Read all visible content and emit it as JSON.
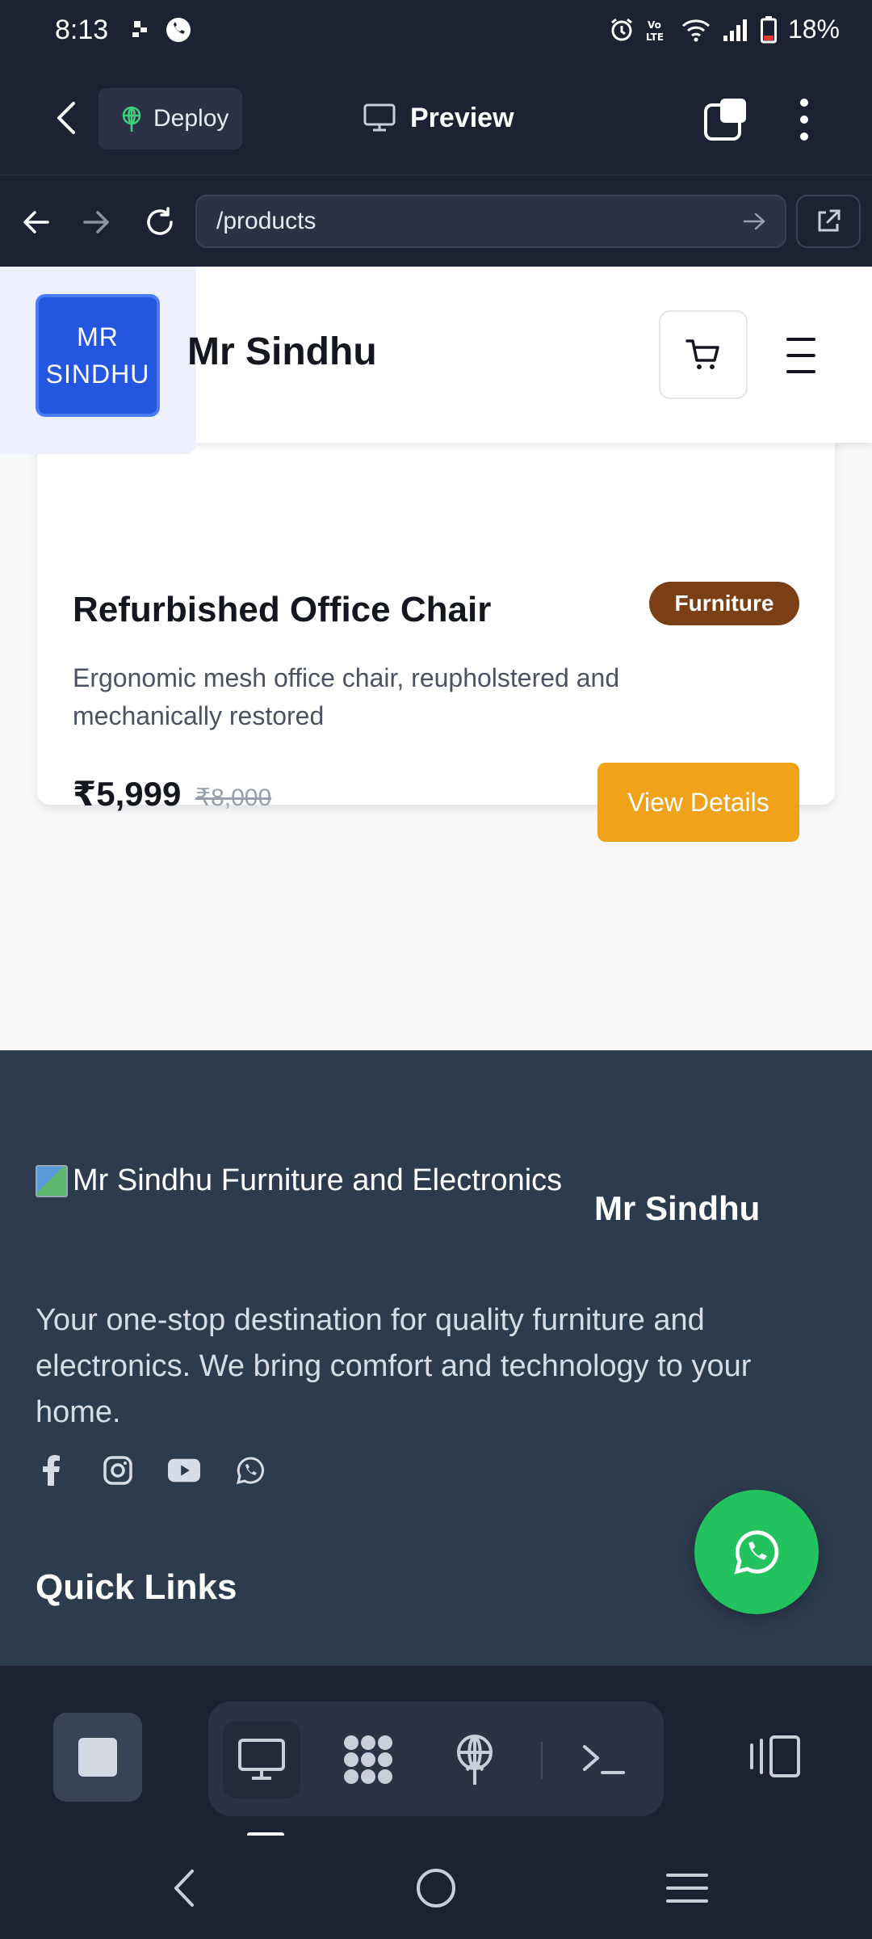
{
  "status_bar": {
    "time": "8:13",
    "battery": "18%"
  },
  "toolbar": {
    "deploy_label": "Deploy",
    "preview_label": "Preview"
  },
  "address_bar": {
    "url": "/products"
  },
  "site": {
    "logo_line1": "MR",
    "logo_line2": "SINDHU",
    "brand_name": "Mr Sindhu"
  },
  "product": {
    "title": "Refurbished Office Chair",
    "category": "Furniture",
    "description": "Ergonomic mesh office chair, reupholstered and mechanically restored",
    "price": "₹5,999",
    "original_price": "₹8,000",
    "cta_label": "View Details"
  },
  "footer": {
    "logo_alt": "Mr Sindhu Furniture and Electronics",
    "brand_name": "Mr Sindhu",
    "tagline": "Your one-stop destination for quality furniture and electronics. We bring comfort and technology to your home.",
    "quick_links_heading": "Quick Links",
    "social_icons": [
      "facebook-icon",
      "instagram-icon",
      "youtube-icon",
      "whatsapp-icon"
    ]
  },
  "colors": {
    "brand_blue": "#2456e0",
    "cta_orange": "#f0a31a",
    "badge_brown": "#7b3f16",
    "footer_bg": "#2d3b4e",
    "whatsapp_green": "#22c35e",
    "app_chrome": "#1c2233"
  }
}
